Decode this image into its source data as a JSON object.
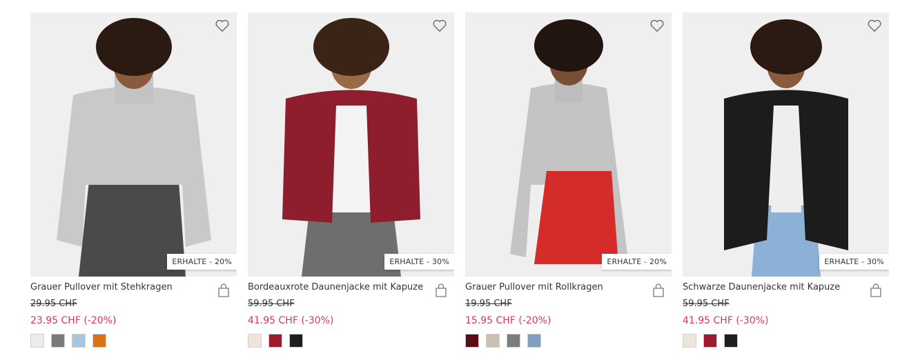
{
  "products": [
    {
      "name": "Grauer Pullover mit Stehkragen",
      "old_price": "29.95 CHF",
      "new_price": "23.95 CHF (-20%)",
      "badge": "ERHALTE - 20%",
      "top_color": "#c9c9c9",
      "bottom_color": "#4a4a4a",
      "swatches": [
        "#ececec",
        "#7a7a7a",
        "#a9c4dd",
        "#d8731a"
      ]
    },
    {
      "name": "Bordeauxrote Daunenjacke mit Kapuze",
      "old_price": "59.95 CHF",
      "new_price": "41.95 CHF (-30%)",
      "badge": "ERHALTE - 30%",
      "top_color": "#8e1e2e",
      "bottom_color": "#6e6e6e",
      "swatches": [
        "#ece6d8",
        "#9c1b2e",
        "#1e1e1e"
      ]
    },
    {
      "name": "Grauer Pullover mit Rollkragen",
      "old_price": "19.95 CHF",
      "new_price": "15.95 CHF (-20%)",
      "badge": "ERHALTE - 20%",
      "top_color": "#c4c4c4",
      "bottom_color": "#d42b2b",
      "swatches": [
        "#5a0d14",
        "#c9c0b0",
        "#7c7c7c",
        "#7e9fbf"
      ]
    },
    {
      "name": "Schwarze Daunenjacke mit Kapuze",
      "old_price": "59.95 CHF",
      "new_price": "41.95 CHF (-30%)",
      "badge": "ERHALTE - 30%",
      "top_color": "#1c1c1c",
      "bottom_color": "#8cb0d6",
      "swatches": [
        "#ece6d8",
        "#9c1b2e",
        "#1e1e1e"
      ]
    }
  ]
}
